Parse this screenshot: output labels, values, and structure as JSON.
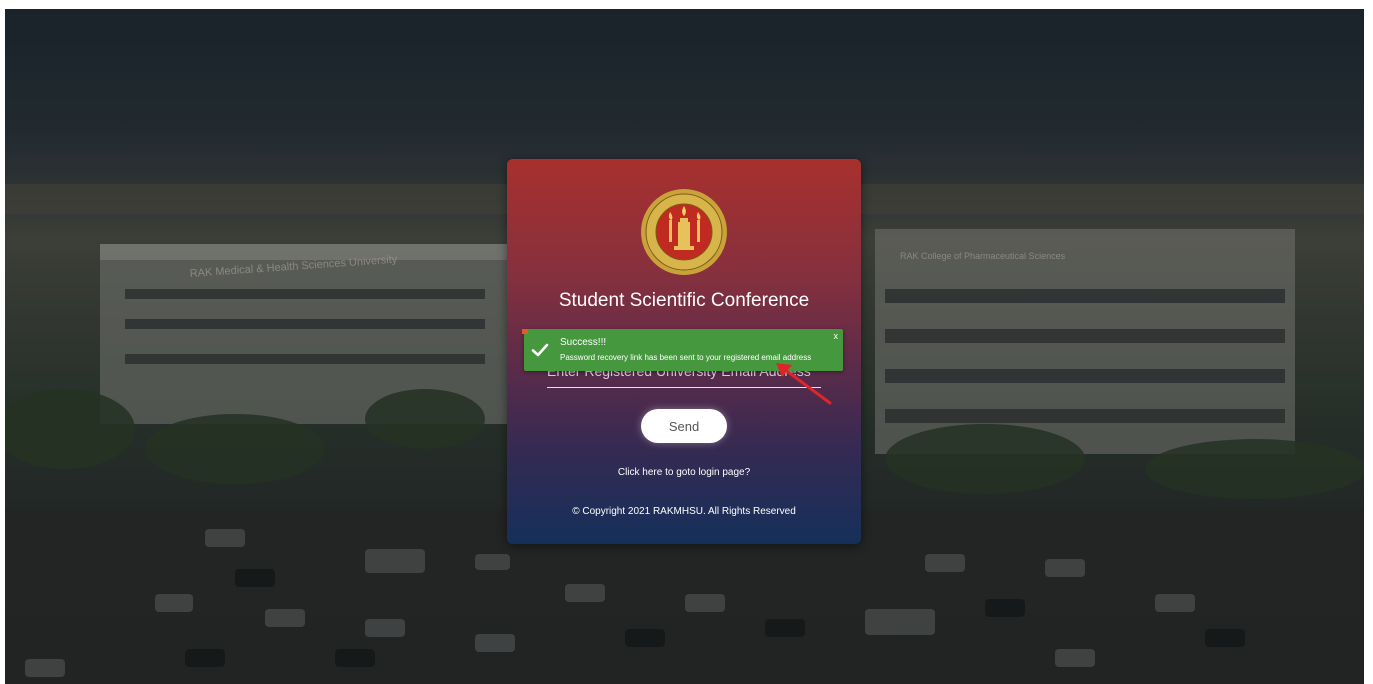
{
  "page": {
    "title": "Student Scientific Conference",
    "email_placeholder": "Enter Registered University Email Address",
    "send_label": "Send",
    "login_link": "Click here to goto login page?",
    "copyright": "© Copyright 2021 RAKMHSU. All Rights Reserved"
  },
  "background": {
    "left_building_sign": "RAK Medical & Health Sciences University",
    "right_building_sign": "RAK College of Pharmaceutical Sciences"
  },
  "toast": {
    "title": "Success!!!",
    "message": "Password recovery link has been sent to your registered email address",
    "close_label": "x"
  },
  "icons": {
    "logo": "university-seal-icon",
    "check": "check-icon",
    "arrow": "red-arrow-icon"
  },
  "colors": {
    "card_top": "#a8302d",
    "card_bottom": "#14305a",
    "toast": "#46983f",
    "arrow": "#e0252a"
  }
}
